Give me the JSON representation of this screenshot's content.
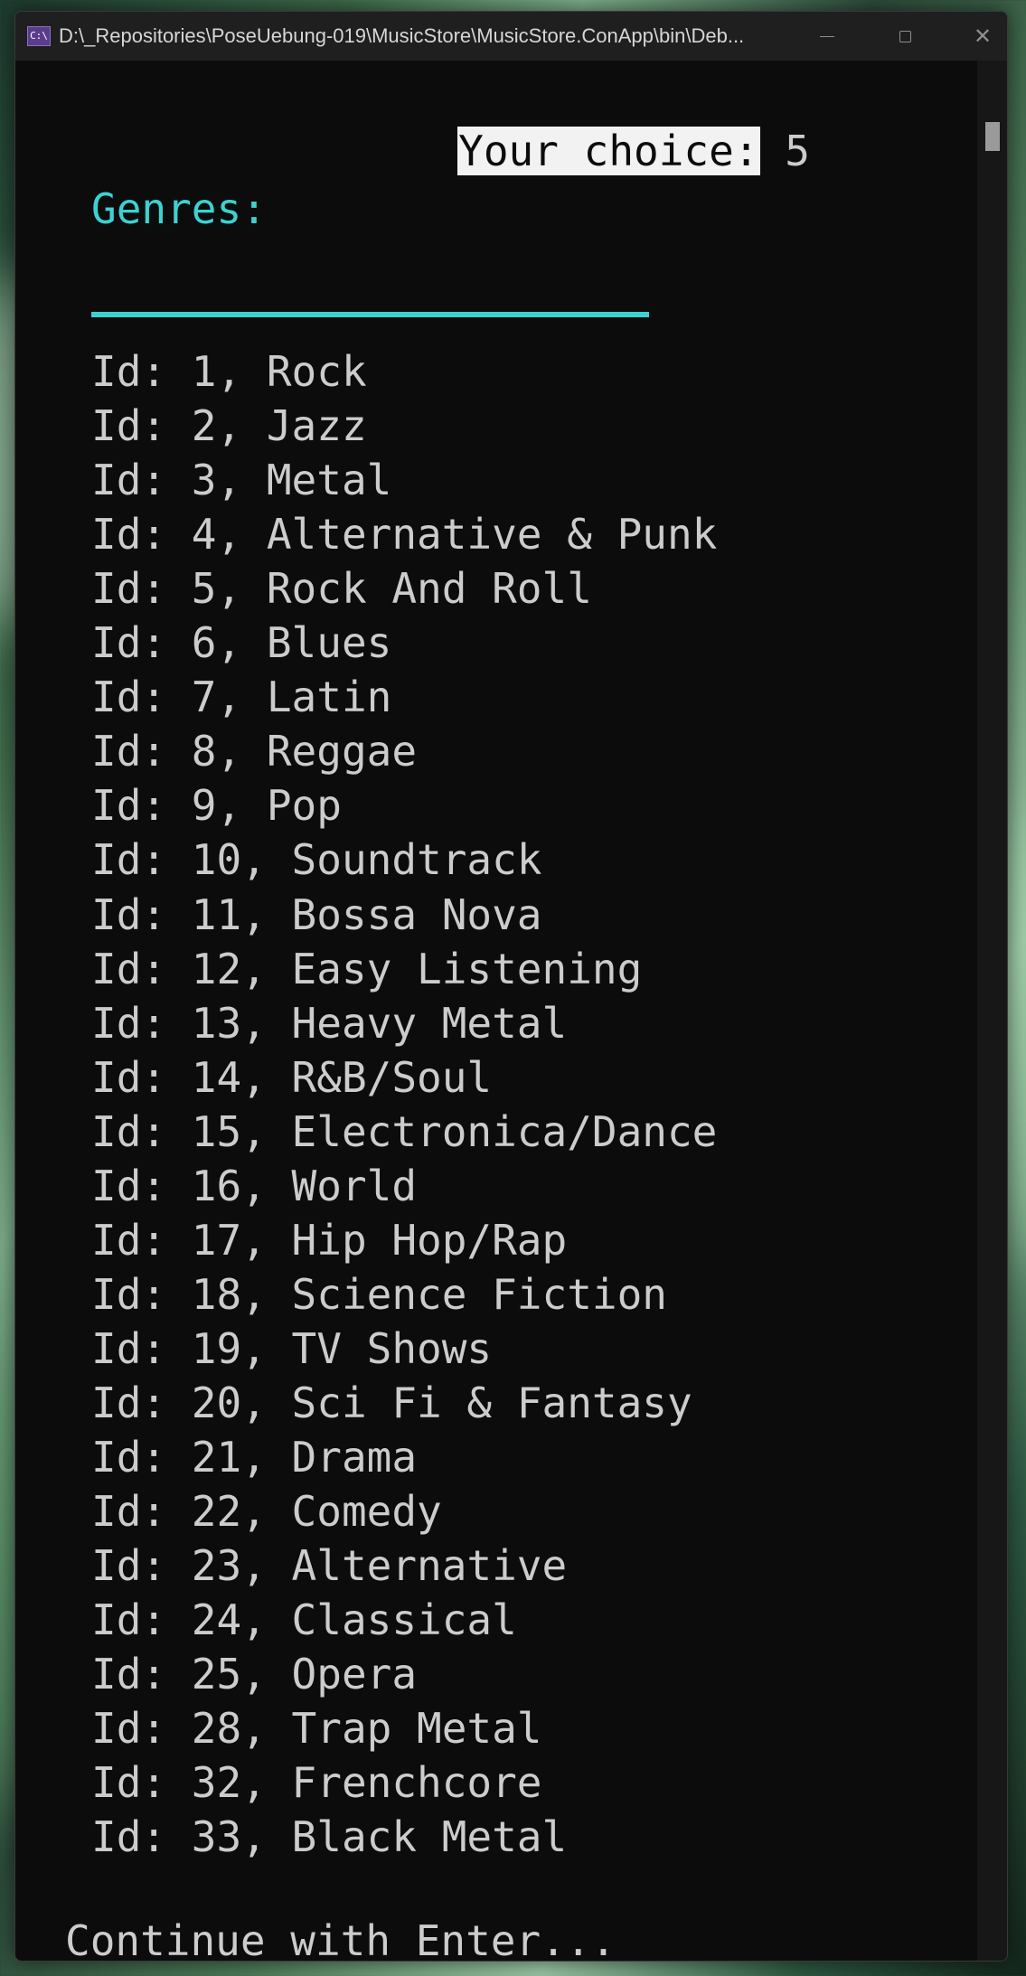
{
  "window": {
    "title": "D:\\_Repositories\\PoseUebung-019\\MusicStore\\MusicStore.ConApp\\bin\\Deb...",
    "icon": "C:\\",
    "buttons": [
      "minimize",
      "maximize",
      "close"
    ],
    "close_glyph": "✕"
  },
  "console": {
    "prompt_label": "Your choice:",
    "prompt_value": " 5",
    "heading": "Genres:",
    "genres": [
      "Id: 1, Rock",
      "Id: 2, Jazz",
      "Id: 3, Metal",
      "Id: 4, Alternative & Punk",
      "Id: 5, Rock And Roll",
      "Id: 6, Blues",
      "Id: 7, Latin",
      "Id: 8, Reggae",
      "Id: 9, Pop",
      "Id: 10, Soundtrack",
      "Id: 11, Bossa Nova",
      "Id: 12, Easy Listening",
      "Id: 13, Heavy Metal",
      "Id: 14, R&B/Soul",
      "Id: 15, Electronica/Dance",
      "Id: 16, World",
      "Id: 17, Hip Hop/Rap",
      "Id: 18, Science Fiction",
      "Id: 19, TV Shows",
      "Id: 20, Sci Fi & Fantasy",
      "Id: 21, Drama",
      "Id: 22, Comedy",
      "Id: 23, Alternative",
      "Id: 24, Classical",
      "Id: 25, Opera",
      "Id: 28, Trap Metal",
      "Id: 32, Frenchcore",
      "Id: 33, Black Metal"
    ],
    "footer": "Continue with Enter..."
  },
  "colors": {
    "background": "#0c0c0c",
    "text": "#cccccc",
    "accent": "#3ed1d1",
    "prompt_highlight": "#f2f2f2"
  }
}
